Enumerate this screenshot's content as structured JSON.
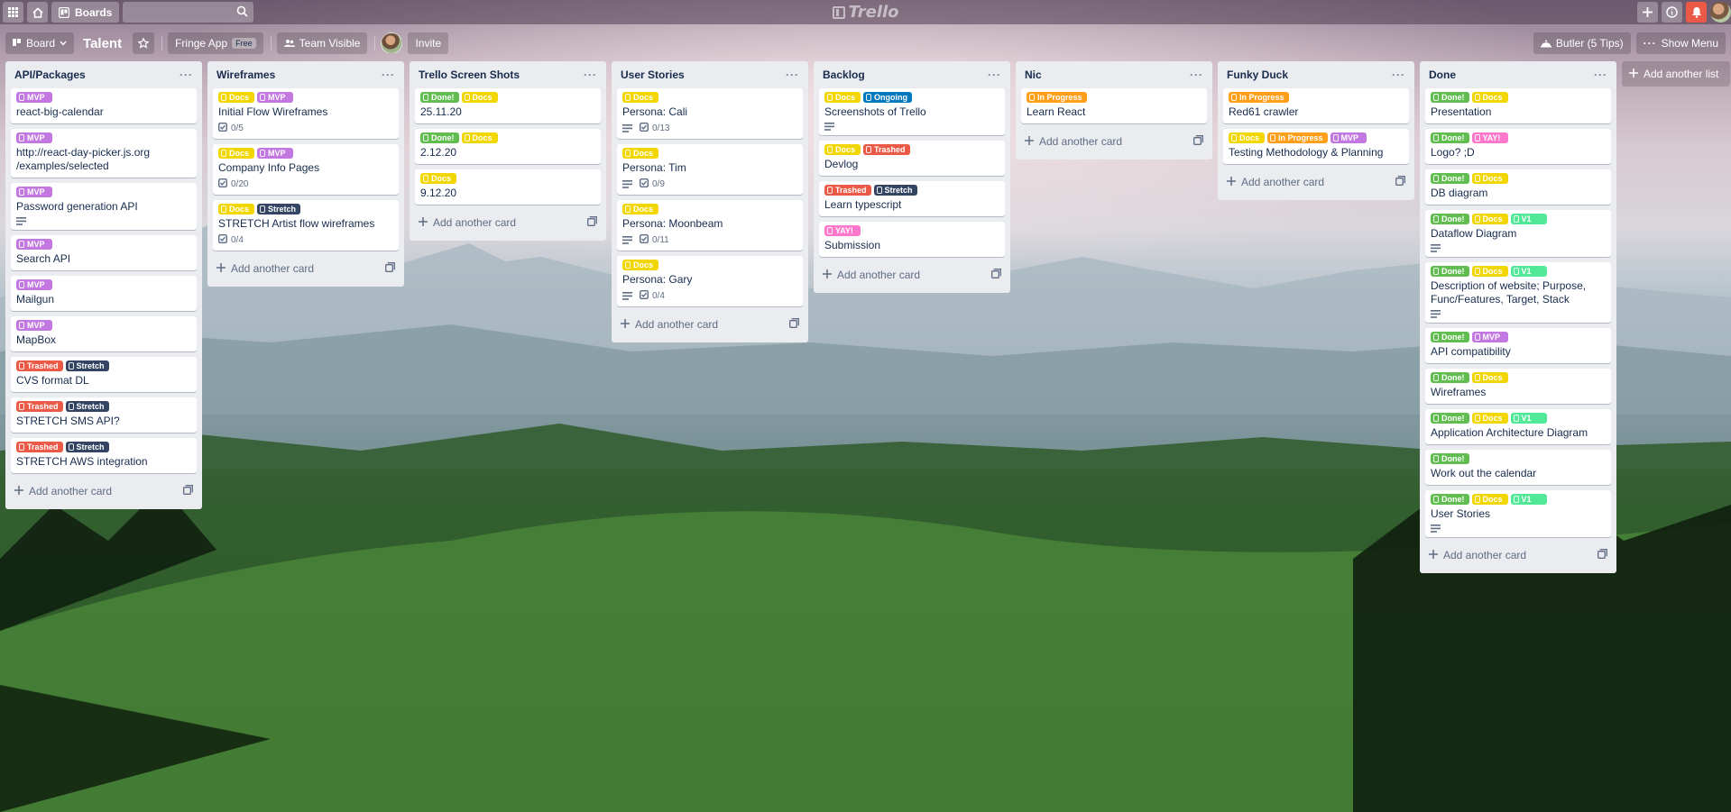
{
  "header": {
    "boards_label": "Boards",
    "logo_text": "Trello"
  },
  "board_bar": {
    "view_label": "Board",
    "title": "Talent",
    "team_label": "Fringe App",
    "team_badge": "Free",
    "visibility_label": "Team Visible",
    "invite_label": "Invite",
    "butler_label": "Butler (5 Tips)",
    "menu_label": "Show Menu"
  },
  "colors": {
    "green": "#61bd4f",
    "yellow": "#f2d600",
    "orange": "#ff9f1a",
    "red": "#eb5a46",
    "purple": "#c377e0",
    "blue": "#0079bf",
    "lime": "#51e898",
    "pink": "#ff78cb",
    "black": "#344563"
  },
  "add_card_label": "Add another card",
  "add_list_label": "Add another list",
  "lists": [
    {
      "title": "API/Packages",
      "cards": [
        {
          "labels": [
            {
              "text": "MVP",
              "color": "purple"
            }
          ],
          "title": "react-big-calendar"
        },
        {
          "labels": [
            {
              "text": "MVP",
              "color": "purple"
            }
          ],
          "title": "http://react-day-picker.js.org /examples/selected"
        },
        {
          "labels": [
            {
              "text": "MVP",
              "color": "purple"
            }
          ],
          "title": "Password generation API",
          "desc": true
        },
        {
          "labels": [
            {
              "text": "MVP",
              "color": "purple"
            }
          ],
          "title": "Search API"
        },
        {
          "labels": [
            {
              "text": "MVP",
              "color": "purple"
            }
          ],
          "title": "Mailgun"
        },
        {
          "labels": [
            {
              "text": "MVP",
              "color": "purple"
            }
          ],
          "title": "MapBox"
        },
        {
          "labels": [
            {
              "text": "Trashed",
              "color": "red"
            },
            {
              "text": "Stretch",
              "color": "black"
            }
          ],
          "title": "CVS format DL"
        },
        {
          "labels": [
            {
              "text": "Trashed",
              "color": "red"
            },
            {
              "text": "Stretch",
              "color": "black"
            }
          ],
          "title": "STRETCH SMS API?"
        },
        {
          "labels": [
            {
              "text": "Trashed",
              "color": "red"
            },
            {
              "text": "Stretch",
              "color": "black"
            }
          ],
          "title": "STRETCH AWS integration"
        }
      ]
    },
    {
      "title": "Wireframes",
      "cards": [
        {
          "labels": [
            {
              "text": "Docs",
              "color": "yellow"
            },
            {
              "text": "MVP",
              "color": "purple"
            }
          ],
          "title": "Initial Flow Wireframes",
          "checklist": "0/5"
        },
        {
          "labels": [
            {
              "text": "Docs",
              "color": "yellow"
            },
            {
              "text": "MVP",
              "color": "purple"
            }
          ],
          "title": "Company Info Pages",
          "checklist": "0/20"
        },
        {
          "labels": [
            {
              "text": "Docs",
              "color": "yellow"
            },
            {
              "text": "Stretch",
              "color": "black"
            }
          ],
          "title": "STRETCH Artist flow wireframes",
          "checklist": "0/4"
        }
      ]
    },
    {
      "title": "Trello Screen Shots",
      "cards": [
        {
          "labels": [
            {
              "text": "Done!",
              "color": "green"
            },
            {
              "text": "Docs",
              "color": "yellow"
            }
          ],
          "title": "25.11.20"
        },
        {
          "labels": [
            {
              "text": "Done!",
              "color": "green"
            },
            {
              "text": "Docs",
              "color": "yellow"
            }
          ],
          "title": "2.12.20"
        },
        {
          "labels": [
            {
              "text": "Docs",
              "color": "yellow"
            }
          ],
          "title": "9.12.20"
        }
      ]
    },
    {
      "title": "User Stories",
      "cards": [
        {
          "labels": [
            {
              "text": "Docs",
              "color": "yellow"
            }
          ],
          "title": "Persona: Cali",
          "desc": true,
          "checklist": "0/13"
        },
        {
          "labels": [
            {
              "text": "Docs",
              "color": "yellow"
            }
          ],
          "title": "Persona: Tim",
          "desc": true,
          "checklist": "0/9"
        },
        {
          "labels": [
            {
              "text": "Docs",
              "color": "yellow"
            }
          ],
          "title": "Persona: Moonbeam",
          "desc": true,
          "checklist": "0/11"
        },
        {
          "labels": [
            {
              "text": "Docs",
              "color": "yellow"
            }
          ],
          "title": "Persona: Gary",
          "desc": true,
          "checklist": "0/4"
        }
      ]
    },
    {
      "title": "Backlog",
      "cards": [
        {
          "labels": [
            {
              "text": "Docs",
              "color": "yellow"
            },
            {
              "text": "Ongoing",
              "color": "blue"
            }
          ],
          "title": "Screenshots of Trello",
          "desc": true
        },
        {
          "labels": [
            {
              "text": "Docs",
              "color": "yellow"
            },
            {
              "text": "Trashed",
              "color": "red"
            }
          ],
          "title": "Devlog"
        },
        {
          "labels": [
            {
              "text": "Trashed",
              "color": "red"
            },
            {
              "text": "Stretch",
              "color": "black"
            }
          ],
          "title": "Learn typescript"
        },
        {
          "labels": [
            {
              "text": "YAY!",
              "color": "pink"
            }
          ],
          "title": "Submission"
        }
      ]
    },
    {
      "title": "Nic",
      "cards": [
        {
          "labels": [
            {
              "text": "In Progress",
              "color": "orange"
            }
          ],
          "title": "Learn React"
        }
      ]
    },
    {
      "title": "Funky Duck",
      "cards": [
        {
          "labels": [
            {
              "text": "In Progress",
              "color": "orange"
            }
          ],
          "title": "Red61 crawler"
        },
        {
          "labels": [
            {
              "text": "Docs",
              "color": "yellow"
            },
            {
              "text": "In Progress",
              "color": "orange"
            },
            {
              "text": "MVP",
              "color": "purple"
            }
          ],
          "title": "Testing Methodology & Planning"
        }
      ]
    },
    {
      "title": "Done",
      "cards": [
        {
          "labels": [
            {
              "text": "Done!",
              "color": "green"
            },
            {
              "text": "Docs",
              "color": "yellow"
            }
          ],
          "title": "Presentation"
        },
        {
          "labels": [
            {
              "text": "Done!",
              "color": "green"
            },
            {
              "text": "YAY!",
              "color": "pink"
            }
          ],
          "title": "Logo? ;D"
        },
        {
          "labels": [
            {
              "text": "Done!",
              "color": "green"
            },
            {
              "text": "Docs",
              "color": "yellow"
            }
          ],
          "title": "DB diagram"
        },
        {
          "labels": [
            {
              "text": "Done!",
              "color": "green"
            },
            {
              "text": "Docs",
              "color": "yellow"
            },
            {
              "text": "V1",
              "color": "lime"
            }
          ],
          "title": "Dataflow Diagram",
          "desc": true
        },
        {
          "labels": [
            {
              "text": "Done!",
              "color": "green"
            },
            {
              "text": "Docs",
              "color": "yellow"
            },
            {
              "text": "V1",
              "color": "lime"
            }
          ],
          "title": "Description of website; Purpose, Func/Features, Target, Stack",
          "desc": true
        },
        {
          "labels": [
            {
              "text": "Done!",
              "color": "green"
            },
            {
              "text": "MVP",
              "color": "purple"
            }
          ],
          "title": "API compatibility"
        },
        {
          "labels": [
            {
              "text": "Done!",
              "color": "green"
            },
            {
              "text": "Docs",
              "color": "yellow"
            }
          ],
          "title": "Wireframes"
        },
        {
          "labels": [
            {
              "text": "Done!",
              "color": "green"
            },
            {
              "text": "Docs",
              "color": "yellow"
            },
            {
              "text": "V1",
              "color": "lime"
            }
          ],
          "title": "Application Architecture Diagram"
        },
        {
          "labels": [
            {
              "text": "Done!",
              "color": "green"
            }
          ],
          "title": "Work out the calendar"
        },
        {
          "labels": [
            {
              "text": "Done!",
              "color": "green"
            },
            {
              "text": "Docs",
              "color": "yellow"
            },
            {
              "text": "V1",
              "color": "lime"
            }
          ],
          "title": "User Stories",
          "desc": true
        }
      ]
    }
  ]
}
